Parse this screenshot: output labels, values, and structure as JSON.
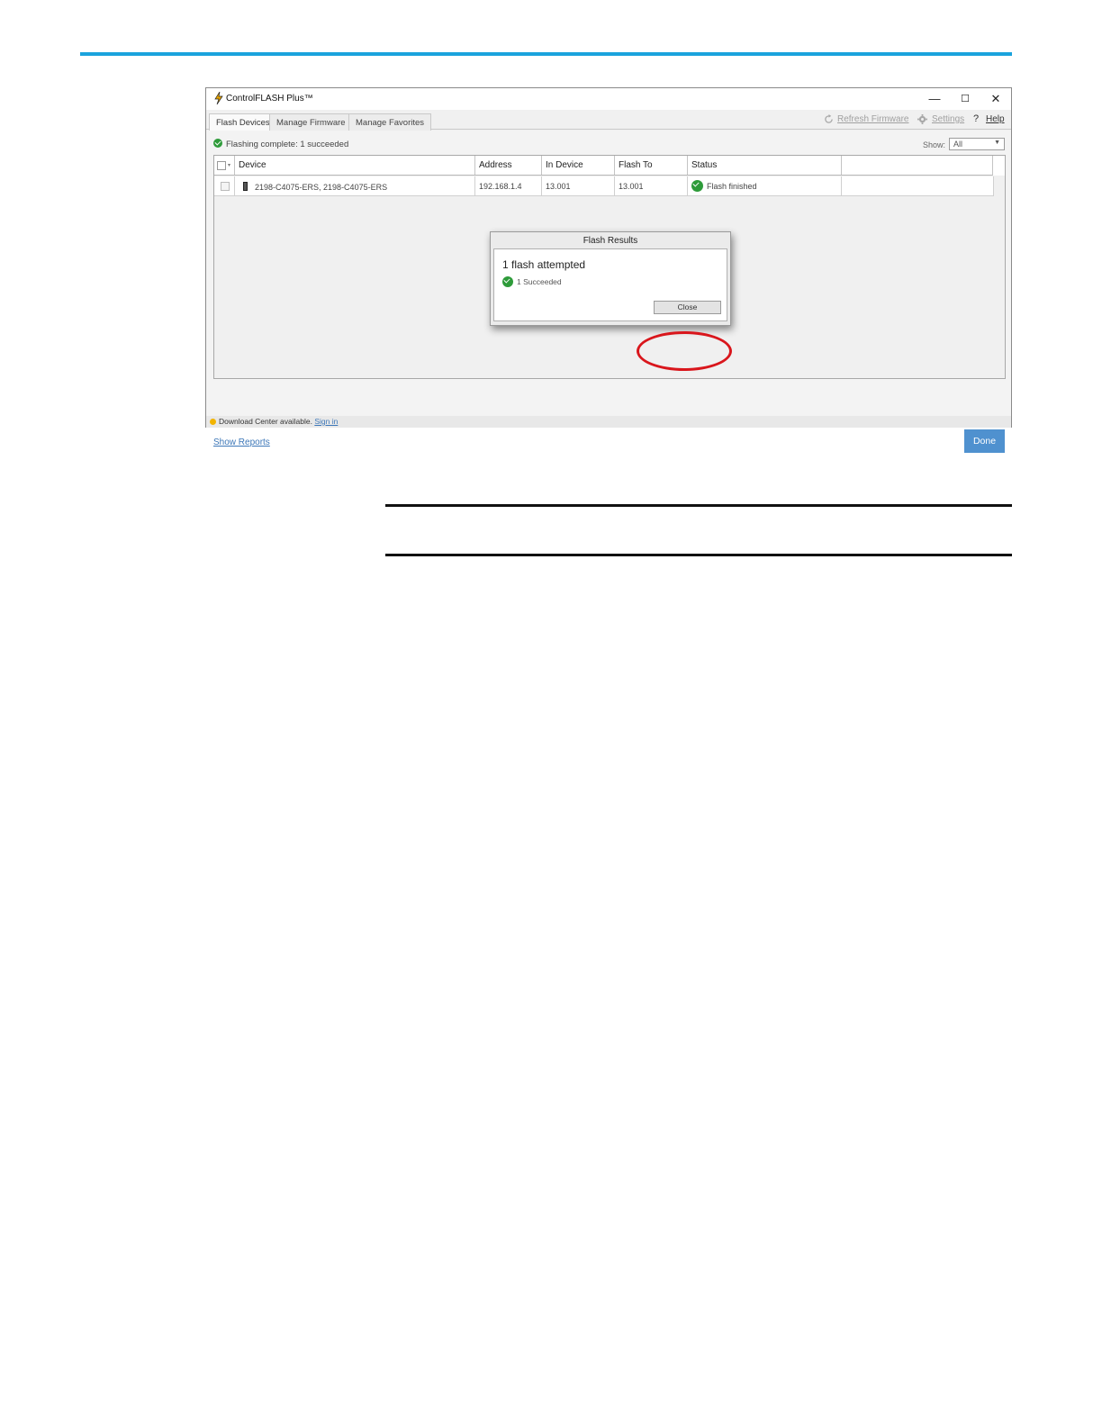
{
  "window": {
    "title": "ControlFLASH Plus™",
    "minimize_glyph": "—",
    "maximize_glyph": "☐",
    "close_glyph": "✕"
  },
  "tabs": [
    {
      "label": "Flash Devices"
    },
    {
      "label": "Manage Firmware"
    },
    {
      "label": "Manage Favorites"
    }
  ],
  "toolbar": {
    "refresh_label": "Refresh Firmware",
    "settings_label": "Settings",
    "help_glyph": "?",
    "help_label": "Help"
  },
  "status": {
    "message": "Flashing complete: 1 succeeded",
    "show_label": "Show:",
    "show_value": "All"
  },
  "table": {
    "columns": [
      "Device",
      "Address",
      "In Device",
      "Flash To",
      "Status"
    ],
    "rows": [
      {
        "device": "2198-C4075-ERS, 2198-C4075-ERS",
        "address": "192.168.1.4",
        "in_device": "13.001",
        "flash_to": "13.001",
        "status": "Flash finished"
      }
    ]
  },
  "dialog": {
    "title": "Flash Results",
    "headline": "1 flash attempted",
    "succeeded": "1 Succeeded",
    "close_label": "Close"
  },
  "footer": {
    "show_reports": "Show Reports",
    "done_label": "Done",
    "statusbar_text": "Download Center available.",
    "statusbar_link": "Sign in"
  },
  "colors": {
    "accent_rule": "#1aa3dd",
    "success": "#2e9b3a",
    "done_button": "#4f91cf",
    "highlight": "#d9161c"
  }
}
